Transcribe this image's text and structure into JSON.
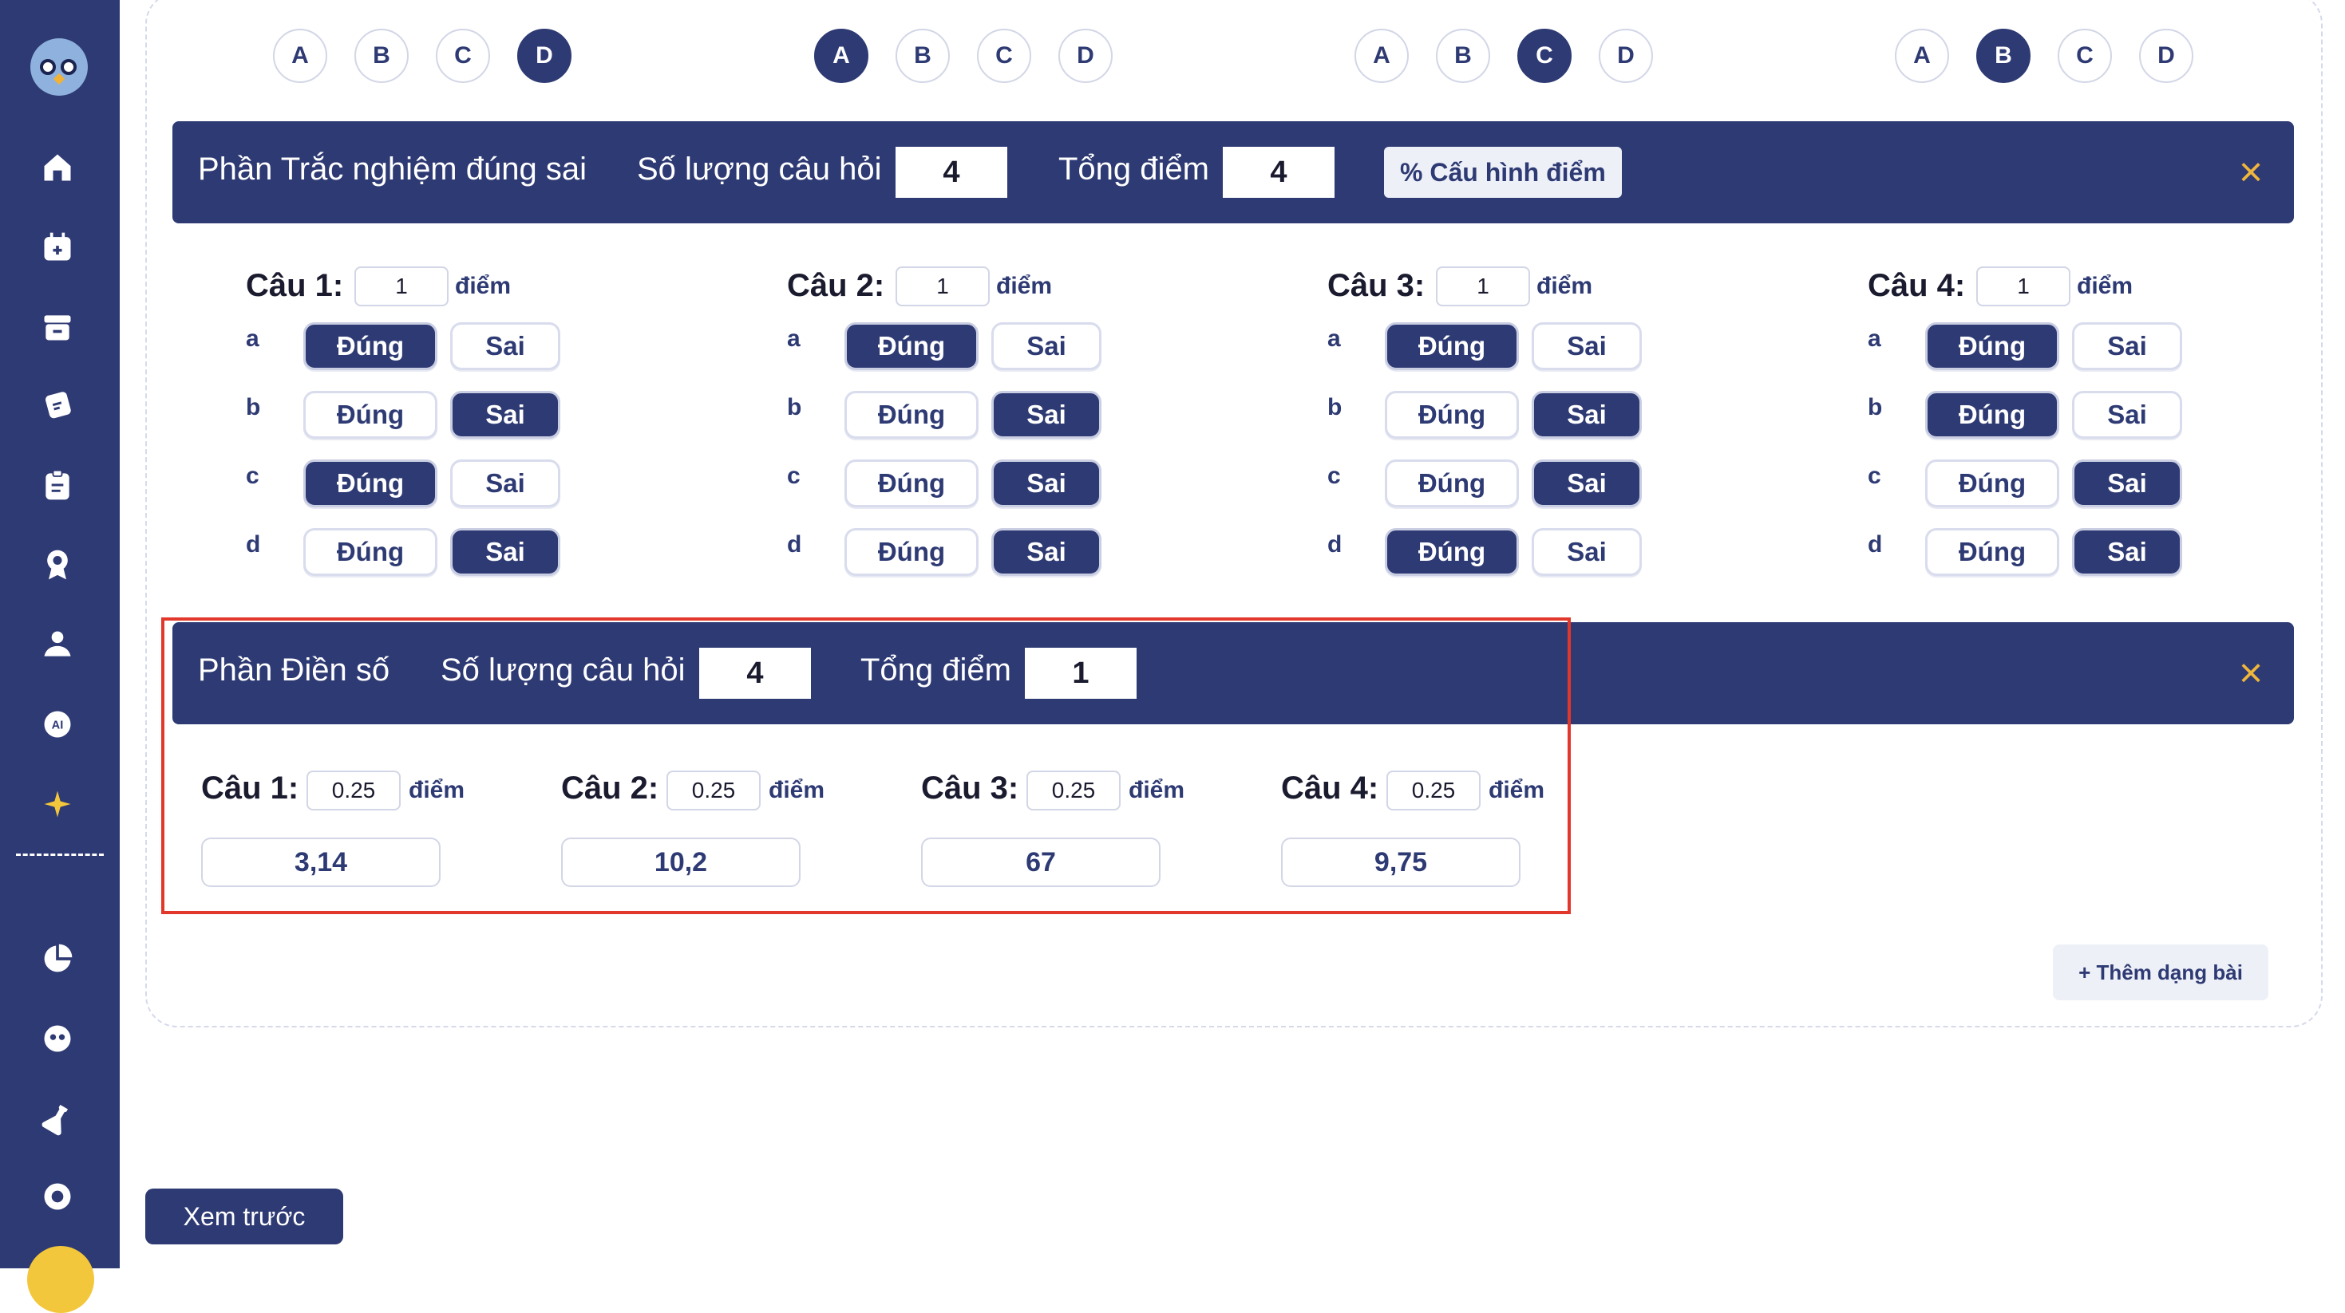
{
  "mcq_rows": [
    {
      "options": [
        "A",
        "B",
        "C",
        "D"
      ],
      "selected": "D"
    },
    {
      "options": [
        "A",
        "B",
        "C",
        "D"
      ],
      "selected": "A"
    },
    {
      "options": [
        "A",
        "B",
        "C",
        "D"
      ],
      "selected": "C"
    },
    {
      "options": [
        "A",
        "B",
        "C",
        "D"
      ],
      "selected": "B"
    }
  ],
  "tf_section": {
    "title": "Phần Trắc nghiệm đúng sai",
    "count_label": "Số lượng câu hỏi",
    "count_value": "4",
    "total_label": "Tổng điểm",
    "total_value": "4",
    "config_button": "% Cấu hình điểm",
    "close": "×",
    "questions": [
      {
        "label": "Câu 1:",
        "score": "1",
        "unit": "điểm",
        "rows": [
          {
            "letter": "a",
            "true_label": "Đúng",
            "false_label": "Sai",
            "answer": "Đúng"
          },
          {
            "letter": "b",
            "true_label": "Đúng",
            "false_label": "Sai",
            "answer": "Sai"
          },
          {
            "letter": "c",
            "true_label": "Đúng",
            "false_label": "Sai",
            "answer": "Đúng"
          },
          {
            "letter": "d",
            "true_label": "Đúng",
            "false_label": "Sai",
            "answer": "Sai"
          }
        ]
      },
      {
        "label": "Câu 2:",
        "score": "1",
        "unit": "điểm",
        "rows": [
          {
            "letter": "a",
            "true_label": "Đúng",
            "false_label": "Sai",
            "answer": "Đúng"
          },
          {
            "letter": "b",
            "true_label": "Đúng",
            "false_label": "Sai",
            "answer": "Sai"
          },
          {
            "letter": "c",
            "true_label": "Đúng",
            "false_label": "Sai",
            "answer": "Sai"
          },
          {
            "letter": "d",
            "true_label": "Đúng",
            "false_label": "Sai",
            "answer": "Sai"
          }
        ]
      },
      {
        "label": "Câu 3:",
        "score": "1",
        "unit": "điểm",
        "rows": [
          {
            "letter": "a",
            "true_label": "Đúng",
            "false_label": "Sai",
            "answer": "Đúng"
          },
          {
            "letter": "b",
            "true_label": "Đúng",
            "false_label": "Sai",
            "answer": "Sai"
          },
          {
            "letter": "c",
            "true_label": "Đúng",
            "false_label": "Sai",
            "answer": "Sai"
          },
          {
            "letter": "d",
            "true_label": "Đúng",
            "false_label": "Sai",
            "answer": "Đúng"
          }
        ]
      },
      {
        "label": "Câu 4:",
        "score": "1",
        "unit": "điểm",
        "rows": [
          {
            "letter": "a",
            "true_label": "Đúng",
            "false_label": "Sai",
            "answer": "Đúng"
          },
          {
            "letter": "b",
            "true_label": "Đúng",
            "false_label": "Sai",
            "answer": "Đúng"
          },
          {
            "letter": "c",
            "true_label": "Đúng",
            "false_label": "Sai",
            "answer": "Sai"
          },
          {
            "letter": "d",
            "true_label": "Đúng",
            "false_label": "Sai",
            "answer": "Sai"
          }
        ]
      }
    ]
  },
  "num_section": {
    "title": "Phần Điền số",
    "count_label": "Số lượng câu hỏi",
    "count_value": "4",
    "total_label": "Tổng điểm",
    "total_value": "1",
    "close": "×",
    "questions": [
      {
        "label": "Câu 1:",
        "score": "0.25",
        "unit": "điểm",
        "answer": "3,14"
      },
      {
        "label": "Câu 2:",
        "score": "0.25",
        "unit": "điểm",
        "answer": "10,2"
      },
      {
        "label": "Câu 3:",
        "score": "0.25",
        "unit": "điểm",
        "answer": "67"
      },
      {
        "label": "Câu 4:",
        "score": "0.25",
        "unit": "điểm",
        "answer": "9,75"
      }
    ]
  },
  "add_section_button": "+ Thêm dạng bài",
  "preview_button": "Xem trước",
  "sidebar": {
    "icons": [
      "home-icon",
      "calendar-add-icon",
      "archive-icon",
      "exam-paper-icon",
      "clipboard-icon",
      "award-icon",
      "users-icon",
      "ai-chat-icon",
      "sparkle-icon",
      "pie-chart-icon",
      "owl-face-icon",
      "flask-icon",
      "lifebuoy-icon"
    ]
  },
  "colors": {
    "primary": "#2e3a73",
    "close": "#f0b63c",
    "highlight": "#e1382b"
  }
}
